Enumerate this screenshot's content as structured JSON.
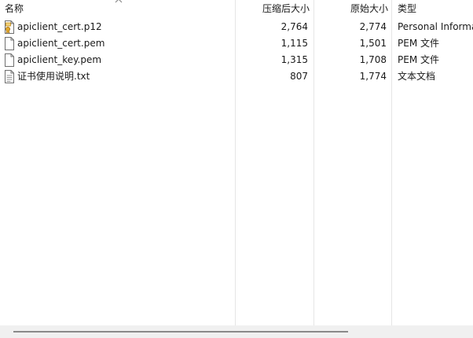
{
  "columns": {
    "name": "名称",
    "packed_size": "压缩后大小",
    "original_size": "原始大小",
    "type": "类型"
  },
  "files": [
    {
      "icon": "certificate-icon",
      "name": "apiclient_cert.p12",
      "packed_size": "2,764",
      "original_size": "2,774",
      "type": "Personal Information Exchange"
    },
    {
      "icon": "file-icon",
      "name": "apiclient_cert.pem",
      "packed_size": "1,115",
      "original_size": "1,501",
      "type": "PEM 文件"
    },
    {
      "icon": "file-icon",
      "name": "apiclient_key.pem",
      "packed_size": "1,315",
      "original_size": "1,708",
      "type": "PEM 文件"
    },
    {
      "icon": "text-file-icon",
      "name": "证书使用说明.txt",
      "packed_size": "807",
      "original_size": "1,774",
      "type": "文本文档"
    }
  ],
  "colors": {
    "divider": "#e5e5e5",
    "scroll_track": "#f0f0f0",
    "scroll_thumb": "#8a8a8a",
    "cert_badge": "#d9a520"
  }
}
